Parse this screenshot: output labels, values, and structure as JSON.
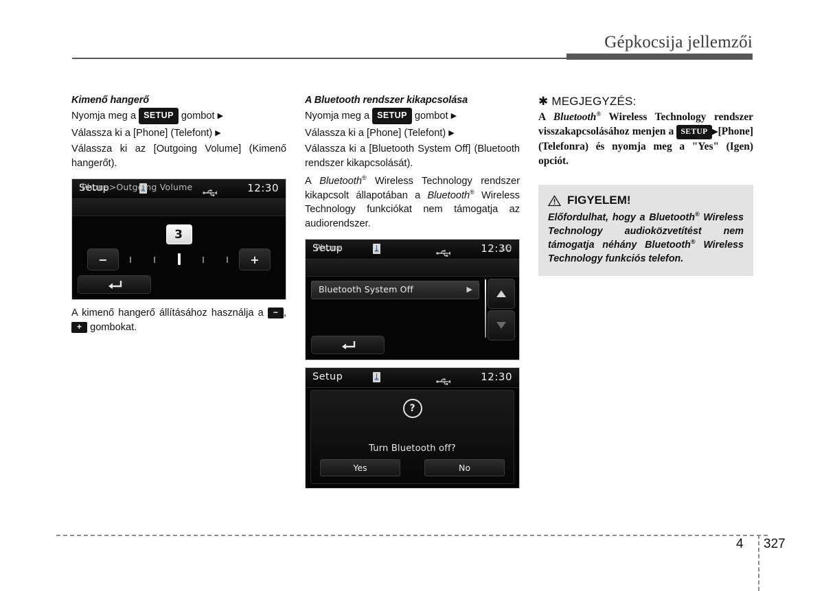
{
  "header": {
    "title": "Gépkocsija jellemzői"
  },
  "footer": {
    "chapter": "4",
    "page": "327"
  },
  "column1": {
    "heading": "Kimenő hangerő",
    "steps": {
      "line1_pre": "Nyomja meg a",
      "setup_label": "SETUP",
      "line1_post": "gombot",
      "arrow": "▶",
      "line2": "Válassza ki a [Phone] (Telefont)",
      "line3": "Válassza ki az [Outgoing Volume] (Kimenő hangerőt)."
    },
    "screen": {
      "title": "Setup",
      "clock": "12:30",
      "bt_glyph": "ᛦ",
      "breadcrumb": "Phone>Outgoing Volume",
      "volume_value": "3",
      "minus_label": "−",
      "plus_label": "+",
      "tick_count": 5,
      "tick_active_index": 3
    },
    "caption_pre": "A kimenő hangerő állításához használja a",
    "caption_minus": "−",
    "caption_comma": ",",
    "caption_plus": "+",
    "caption_post": "gombokat."
  },
  "column2": {
    "heading": "A Bluetooth rendszer kikapcsolása",
    "steps": {
      "line1_pre": "Nyomja meg a",
      "setup_label": "SETUP",
      "line1_post": "gombot",
      "arrow": "▶",
      "line2": "Válassza ki a [Phone] (Telefont)",
      "line3": "Válassza ki a [Bluetooth System Off] (Bluetooth rendszer kikapcsolását)."
    },
    "paragraph": {
      "p1": "A",
      "bt1": "Bluetooth",
      "reg1": "®",
      "p2": "Wireless Technology rendszer kikapcsolt állapotában a",
      "bt2": "Bluetooth",
      "reg2": "®",
      "p3": "Wireless Technology funkciókat nem támogatja az audiorendszer."
    },
    "screen_list": {
      "title": "Setup",
      "clock": "12:30",
      "breadcrumb": "Phone",
      "page_indicator": "3/3",
      "item_label": "Bluetooth System Off",
      "item_arrow": "▶",
      "scroll_up": "▲",
      "scroll_down": "▼"
    },
    "screen_dialog": {
      "title": "Setup",
      "clock": "12:30",
      "icon": "?",
      "message": "Turn Bluetooth off?",
      "yes_label": "Yes",
      "no_label": "No"
    }
  },
  "column3": {
    "note": {
      "marker": "✱",
      "heading": "MEGJEGYZÉS:",
      "t1": "A",
      "bt": "Bluetooth",
      "reg": "®",
      "t2": "Wireless Technology rendszer visszakapcsolásához menjen a",
      "setup_label": "SETUP",
      "arrow": "▶",
      "t3": "[Phone] (Telefonra) és nyomja meg a \"Yes\" (Igen) opciót."
    },
    "warning": {
      "icon": "warning-triangle",
      "heading": "FIGYELEM!",
      "t1": "Előfordulhat, hogy a",
      "bt1": "Bluetooth",
      "reg1": "®",
      "t2": "Wireless Technology audioközvetítést nem támogatja néhány",
      "bt2": "Bluetooth",
      "reg2": "®",
      "t3": "Wireless Technology funkciós telefon."
    }
  },
  "colors": {
    "rule": "#585858",
    "warn_bg": "#e3e3e3",
    "screen_bg": "#050505",
    "bt_blue": "#1b4e86"
  }
}
